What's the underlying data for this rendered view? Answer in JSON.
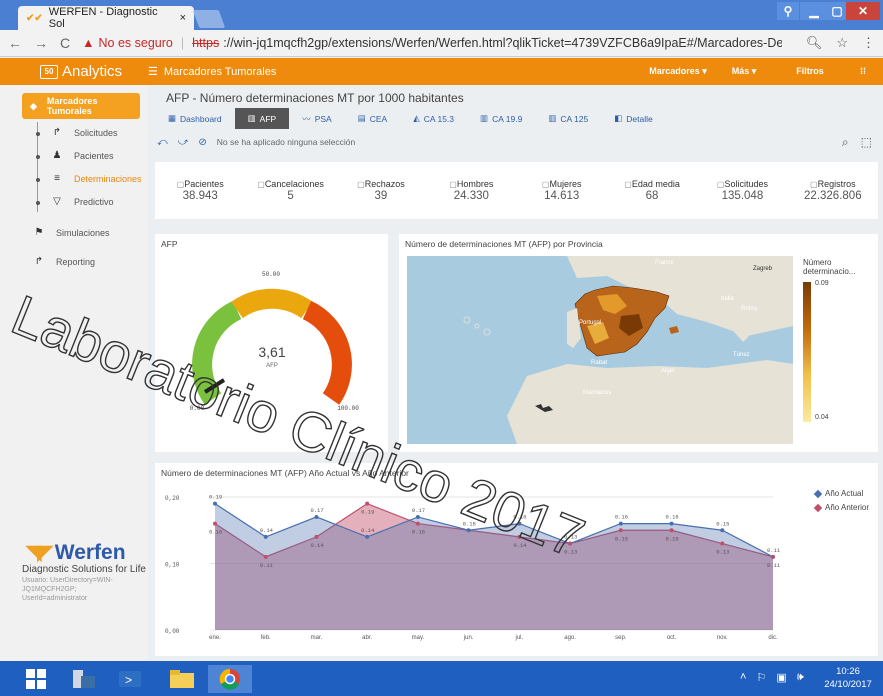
{
  "browser": {
    "tab_title": "WERFEN - Diagnostic Sol",
    "tab_close": "×",
    "not_secure": "No es seguro",
    "url_scheme": "https",
    "url_rest": "://win-jq1mqcfh2gp/extensions/Werfen/Werfen.html?qlikTicket=4739VZFCB6a9IpaE#/Marcadores-Determin..."
  },
  "header": {
    "app_name": "Analytics",
    "app_icon_text": "50",
    "menu_label": "Marcadores Tumorales",
    "right": [
      "Marcadores ▾",
      "Más ▾",
      "Filtros",
      "⁞⁞"
    ]
  },
  "sidebar": {
    "active": "Marcadores Tumorales",
    "sub_items": [
      "Solicitudes",
      "Pacientes",
      "Determinaciones",
      "Predictivo"
    ],
    "items": [
      "Simulaciones",
      "Reporting"
    ],
    "logo_text": "Werfen",
    "tagline": "Diagnostic Solutions for Life",
    "user_line": "Usuario: UserDirectory=WIN-JQ1MQCFH2GP; UserId=administrator"
  },
  "main": {
    "title": "AFP - Número determinaciones MT por 1000 habitantes",
    "tabs": [
      "Dashboard",
      "AFP",
      "PSA",
      "CEA",
      "CA 15.3",
      "CA 19.9",
      "CA 125",
      "Detalle"
    ],
    "active_tab": "AFP",
    "selection_msg": "No se ha aplicado ninguna selección"
  },
  "kpis": [
    {
      "label": "Pacientes",
      "value": "38.943"
    },
    {
      "label": "Cancelaciones",
      "value": "5"
    },
    {
      "label": "Rechazos",
      "value": "39"
    },
    {
      "label": "Hombres",
      "value": "24.330"
    },
    {
      "label": "Mujeres",
      "value": "14.613"
    },
    {
      "label": "Edad media",
      "value": "68"
    },
    {
      "label": "Solicitudes",
      "value": "135.048"
    },
    {
      "label": "Registros",
      "value": "22.326.806"
    }
  ],
  "gauge": {
    "title": "AFP",
    "value": "3,61",
    "unit": "AFP",
    "min_label": "0.00",
    "mid_label": "50.00",
    "max_label": "100.00"
  },
  "map": {
    "title": "Número de determinaciones MT (AFP) por Provincia",
    "legend_title": "Número determinacio...",
    "legend_max": "0.09",
    "legend_min": "0.04",
    "place_labels": [
      "France",
      "Zagreb",
      "Italia",
      "Roma",
      "Portugal",
      "Alger",
      "Rabat",
      "Marruecos",
      "Túnez"
    ]
  },
  "chart_data": {
    "type": "area",
    "title": "Número de determinaciones MT (AFP) Año Actual vs Año Anterior",
    "categories": [
      "ene.",
      "feb.",
      "mar.",
      "abr.",
      "may.",
      "jun.",
      "jul.",
      "ago.",
      "sep.",
      "oct.",
      "nov.",
      "dic."
    ],
    "series": [
      {
        "name": "Año Actual",
        "color": "#4a6fb0",
        "values": [
          0.19,
          0.14,
          0.17,
          0.14,
          0.17,
          0.15,
          0.16,
          0.13,
          0.16,
          0.16,
          0.15,
          0.11
        ]
      },
      {
        "name": "Año Anterior",
        "color": "#c0506a",
        "values": [
          0.16,
          0.11,
          0.14,
          0.19,
          0.16,
          null,
          0.14,
          0.13,
          0.15,
          0.15,
          0.13,
          0.11
        ]
      }
    ],
    "ylim": [
      0,
      0.2
    ],
    "yticks": [
      "0,00",
      "0,10",
      "0,20"
    ]
  },
  "watermark": "Laboratorio Clínico 2017",
  "taskbar": {
    "time": "10:26",
    "date": "24/10/2017"
  }
}
